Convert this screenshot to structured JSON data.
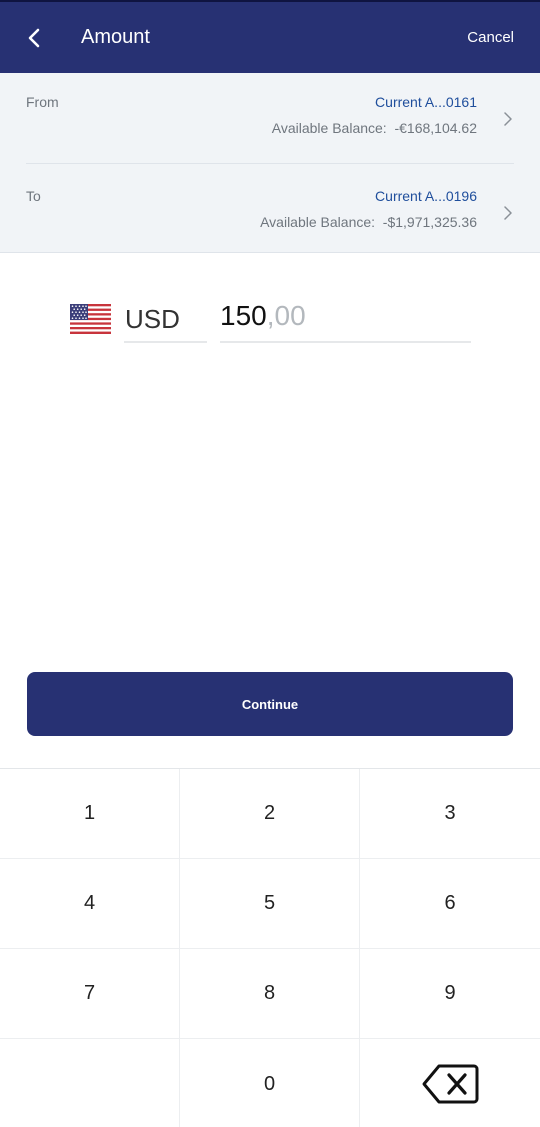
{
  "header": {
    "title": "Amount",
    "cancel_label": "Cancel"
  },
  "accounts": {
    "from": {
      "label": "From",
      "name": "Current A...0161",
      "balance": "Available Balance:  -€168,104.62"
    },
    "to": {
      "label": "To",
      "name": "Current A...0196",
      "balance": "Available Balance:  -$1,971,325.36"
    }
  },
  "amount": {
    "currency": "USD",
    "currency_flag_icon": "us-flag-icon",
    "integer": "150",
    "decimal": ",00"
  },
  "continue_label": "Continue",
  "keypad": {
    "keys": [
      "1",
      "2",
      "3",
      "4",
      "5",
      "6",
      "7",
      "8",
      "9",
      "",
      "0"
    ],
    "backspace_icon": "backspace-icon"
  },
  "colors": {
    "header_bg": "#273173",
    "accent_link": "#1f4e9c",
    "panel_bg": "#f1f4f7"
  }
}
